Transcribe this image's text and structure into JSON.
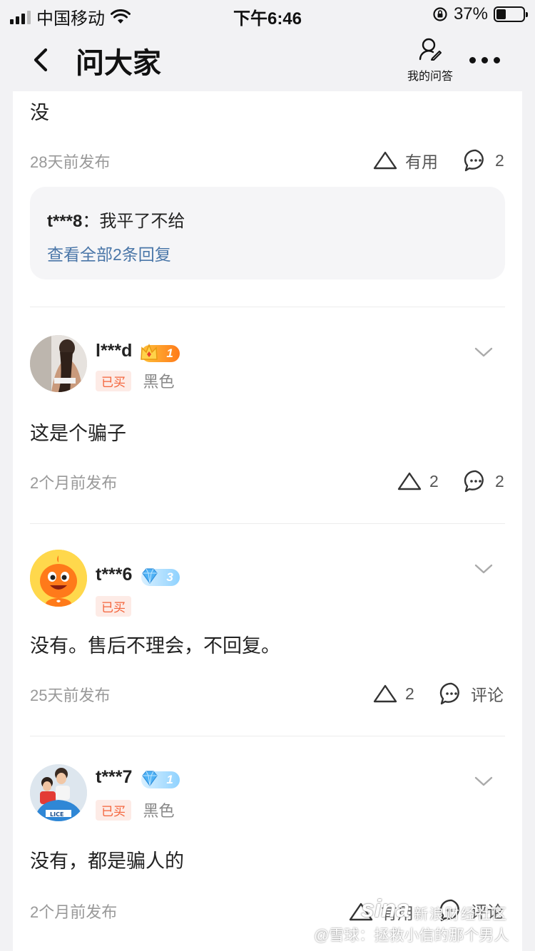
{
  "status_bar": {
    "carrier": "中国移动",
    "time": "下午6:46",
    "battery_percent": "37%",
    "battery_level": 0.37
  },
  "nav": {
    "title": "问大家",
    "my_qa_label": "我的问答"
  },
  "answers": [
    {
      "text": "没",
      "time": "28天前发布",
      "useful_label": "有用",
      "comment_count": "2",
      "reply": {
        "user": "t***8",
        "separator": "：",
        "text": "我平了不给",
        "view_all": "查看全部2条回复"
      }
    },
    {
      "user": "l***d",
      "level": "1",
      "bought_label": "已买",
      "variant": "黑色",
      "text": "这是个骗子",
      "time": "2个月前发布",
      "useful_count": "2",
      "comment_count": "2"
    },
    {
      "user": "t***6",
      "level": "3",
      "bought_label": "已买",
      "text": "没有。售后不理会，不回复。",
      "time": "25天前发布",
      "useful_count": "2",
      "comment_label": "评论"
    },
    {
      "user": "t***7",
      "level": "1",
      "bought_label": "已买",
      "variant": "黑色",
      "text": "没有，都是骗人的",
      "time": "2个月前发布",
      "useful_label": "有用",
      "comment_label": "评论"
    }
  ],
  "watermark": {
    "brand": "sina",
    "brand_sub": "新浪财经社区",
    "line": "@雪球：拯救小信的那个男人"
  },
  "colors": {
    "background": "#f2f2f4",
    "card": "#ffffff",
    "link": "#4a76a8",
    "bought_text": "#f4633a",
    "bought_bg": "#fdebe6",
    "crown_badge": "#ff9a2a",
    "diamond_badge": "#8fd2ff"
  }
}
